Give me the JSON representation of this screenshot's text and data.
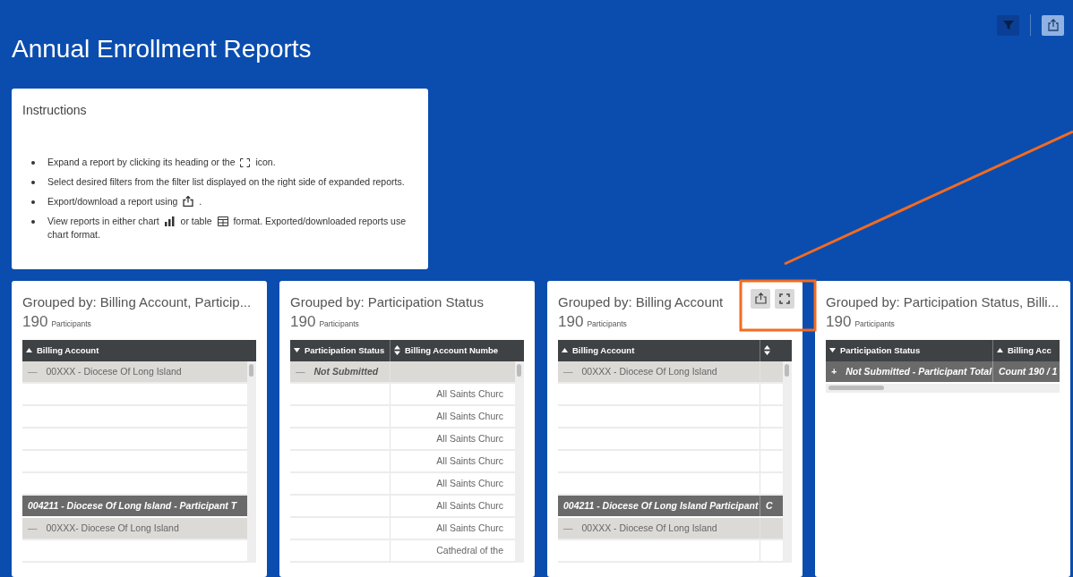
{
  "title": "Annual Enrollment Reports",
  "instructions": {
    "title": "Instructions",
    "items": [
      {
        "parts": [
          {
            "kind": "text",
            "text": "Expand a report by clicking its heading or the"
          },
          {
            "kind": "expand"
          },
          {
            "kind": "text",
            "text": "icon."
          }
        ]
      },
      {
        "parts": [
          {
            "kind": "text",
            "text": "Select desired filters from the filter list displayed on the right side of expanded reports."
          }
        ]
      },
      {
        "parts": [
          {
            "kind": "text",
            "text": "Export/download a report using"
          },
          {
            "kind": "export"
          },
          {
            "kind": "text",
            "text": "."
          }
        ]
      },
      {
        "parts": [
          {
            "kind": "text",
            "text": "View reports in either chart"
          },
          {
            "kind": "chart"
          },
          {
            "kind": "text",
            "text": "or table"
          },
          {
            "kind": "table"
          },
          {
            "kind": "text",
            "text": "format. Exported/downloaded reports use"
          },
          {
            "kind": "break"
          },
          {
            "kind": "text",
            "text": "chart format."
          }
        ]
      }
    ]
  },
  "reports": [
    {
      "title": "Grouped by: Billing Account, Particip...",
      "count": "190",
      "unit": "Participants",
      "actions_visible": false,
      "vertical_scroll": true,
      "columns": [
        {
          "label": "Billing Account",
          "sort_up": true,
          "sort_down": false
        }
      ],
      "rows": [
        {
          "kind": "group",
          "toggle": "—",
          "emphasis": false,
          "cells": [
            "00XXX - Diocese Of Long Island"
          ]
        },
        {
          "kind": "blank"
        },
        {
          "kind": "blank"
        },
        {
          "kind": "blank"
        },
        {
          "kind": "blank"
        },
        {
          "kind": "blank"
        },
        {
          "kind": "total",
          "cells": [
            "004211 - Diocese Of Long Island - Participant T"
          ]
        },
        {
          "kind": "group",
          "toggle": "—",
          "emphasis": false,
          "cells": [
            "00XXX- Diocese Of Long Island"
          ]
        },
        {
          "kind": "blank"
        }
      ]
    },
    {
      "title": "Grouped by: Participation Status",
      "count": "190",
      "unit": "Participants",
      "actions_visible": false,
      "vertical_scroll": true,
      "columns": [
        {
          "label": "Participation Status",
          "sort_up": false,
          "sort_down": true
        },
        {
          "label": "Billing Account Numbe",
          "sort_up": true,
          "sort_down": true
        }
      ],
      "rows": [
        {
          "kind": "group",
          "toggle": "—",
          "emphasis": true,
          "cells": [
            "Not Submitted"
          ]
        },
        {
          "kind": "detail",
          "value": "All Saints Churc"
        },
        {
          "kind": "detail",
          "value": "All Saints Churc"
        },
        {
          "kind": "detail",
          "value": "All Saints Churc"
        },
        {
          "kind": "detail",
          "value": "All Saints Churc"
        },
        {
          "kind": "detail",
          "value": "All Saints Churc"
        },
        {
          "kind": "detail",
          "value": "All Saints Churc"
        },
        {
          "kind": "detail",
          "value": "All Saints Churc"
        },
        {
          "kind": "detail",
          "value": "Cathedral of the"
        }
      ]
    },
    {
      "title": "Grouped by: Billing Account",
      "count": "190",
      "unit": "Participants",
      "actions_visible": true,
      "vertical_scroll": true,
      "columns": [
        {
          "label": "Billing Account",
          "sort_up": true,
          "sort_down": false
        },
        {
          "sort_up": true,
          "sort_down": true
        }
      ],
      "rows": [
        {
          "kind": "group",
          "toggle": "—",
          "emphasis": false,
          "cells": [
            "00XXX - Diocese Of Long Island"
          ]
        },
        {
          "kind": "blank"
        },
        {
          "kind": "blank"
        },
        {
          "kind": "blank"
        },
        {
          "kind": "blank"
        },
        {
          "kind": "blank"
        },
        {
          "kind": "total",
          "cells": [
            "004211 - Diocese Of Long Island Participant",
            "C"
          ]
        },
        {
          "kind": "group",
          "toggle": "—",
          "emphasis": false,
          "cells": [
            "00XXX - Diocese Of Long Island"
          ]
        },
        {
          "kind": "blank"
        }
      ]
    },
    {
      "title": "Grouped by: Participation Status, Billi...",
      "count": "190",
      "unit": "Participants",
      "actions_visible": false,
      "vertical_scroll": false,
      "columns": [
        {
          "label": "Participation Status",
          "sort_up": false,
          "sort_down": true
        },
        {
          "label": "Billing Acc",
          "sort_up": true,
          "sort_down": false
        }
      ],
      "rows": [
        {
          "kind": "total",
          "toggle": "+",
          "cells": [
            "Not Submitted - Participant Total",
            "Count 190 / 1"
          ]
        }
      ]
    }
  ]
}
